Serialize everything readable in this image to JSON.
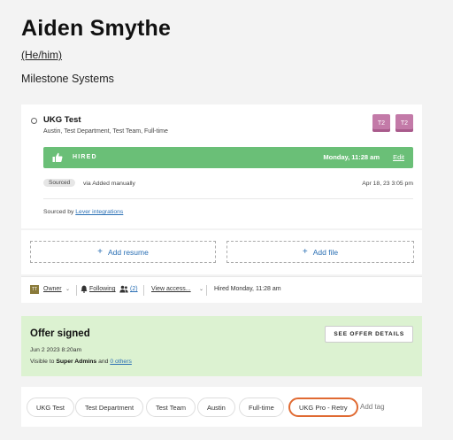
{
  "candidate": {
    "name": "Aiden Smythe",
    "pronouns": "(He/him)",
    "company": "Milestone Systems"
  },
  "opportunity": {
    "posting_title": "UKG Test",
    "posting_meta": "Austin, Test Department, Test Team, Full-time",
    "avatars": [
      "T2",
      "T2"
    ],
    "stage": {
      "label": "HIRED",
      "date": "Monday, 11:28 am",
      "edit_label": "Edit",
      "color": "#6abf77"
    },
    "source": {
      "badge": "Sourced",
      "via": "via Added manually",
      "date": "Apr 18, 23 3:05 pm"
    },
    "sourced_by_label": "Sourced by",
    "sourced_by_link": "Lever integrations"
  },
  "uploads": {
    "add_resume": "Add resume",
    "add_file": "Add file"
  },
  "owner_bar": {
    "owner_avatar": "TT",
    "owner_label": "Owner",
    "following_label": "Following",
    "followers_count": "(2)",
    "view_access_label": "View access...",
    "hired_text": "Hired Monday, 11:28 am"
  },
  "offer": {
    "title": "Offer signed",
    "date": "Jun 2 2023 8:20am",
    "visible_prefix": "Visible to",
    "visible_group": "Super Admins",
    "visible_and": "and",
    "visible_others": "0 others",
    "button_label": "SEE OFFER DETAILS",
    "background": "#dcf2d1"
  },
  "tags": {
    "items": [
      "UKG Test",
      "Test Department",
      "Test Team",
      "Austin",
      "Full-time",
      "UKG Pro - Retry"
    ],
    "highlighted": "UKG Pro - Retry",
    "add_label": "Add tag",
    "highlight_color": "#e06a32"
  },
  "colors": {
    "link": "#2a6fb4",
    "avatar": "#c37aa8"
  }
}
